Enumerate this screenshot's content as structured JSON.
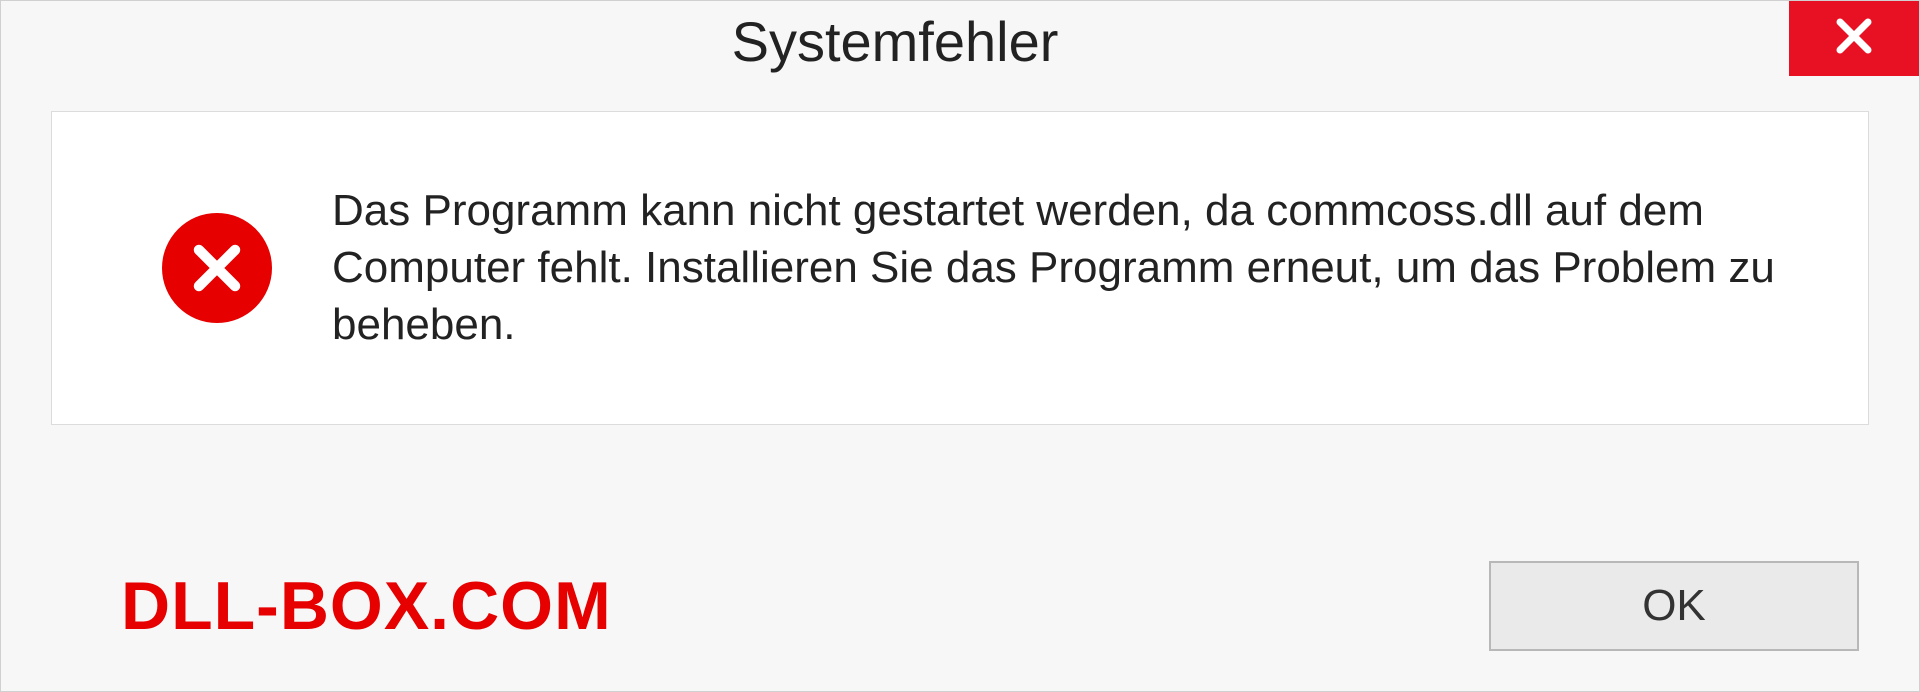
{
  "dialog": {
    "title": "Systemfehler",
    "message": "Das Programm kann nicht gestartet werden, da commcoss.dll auf dem Computer fehlt. Installieren Sie das Programm erneut, um das Problem zu beheben.",
    "ok_label": "OK"
  },
  "watermark": "DLL-BOX.COM",
  "colors": {
    "close_button": "#e81123",
    "error_icon": "#e60000",
    "watermark": "#e60000"
  }
}
